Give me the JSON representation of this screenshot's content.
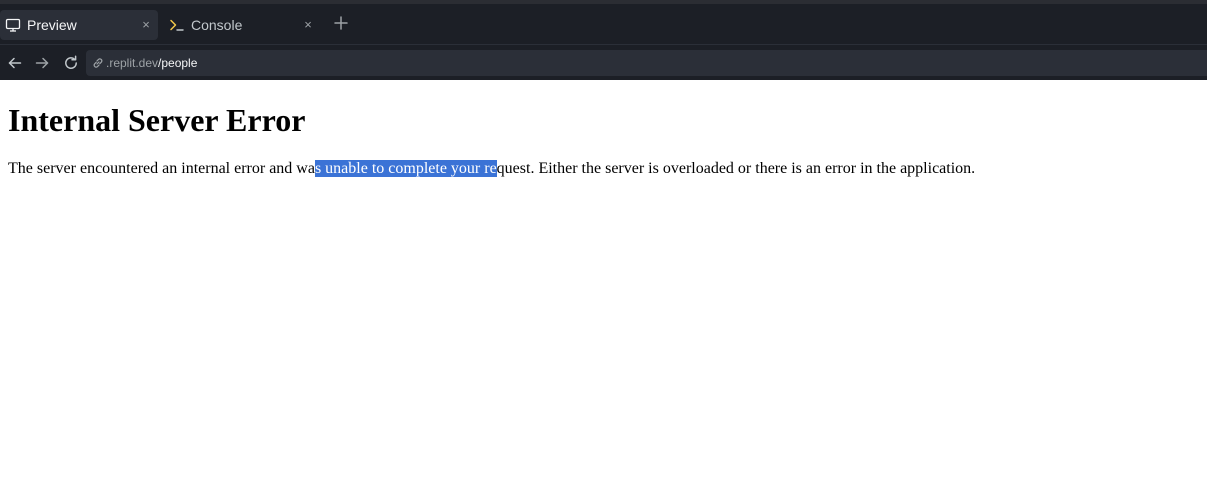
{
  "browser": {
    "tabs": [
      {
        "label": "Preview",
        "active": true,
        "icon": "monitor-icon"
      },
      {
        "label": "Console",
        "active": false,
        "icon": "terminal-icon"
      }
    ],
    "close_glyph": "×",
    "url": {
      "domain": ".replit.dev",
      "path": "/people"
    }
  },
  "page": {
    "title": "Internal Server Error",
    "message": {
      "before_selection": "The server encountered an internal error and wa",
      "selected": "s unable to complete your re",
      "after_selection": "quest. Either the server is overloaded or there is an error in the application."
    }
  },
  "colors": {
    "chrome_bg": "#1c1f26",
    "active_tab_bg": "#2b2f38",
    "selection": "#3b73d6",
    "terminal_accent": "#f2c84b"
  }
}
